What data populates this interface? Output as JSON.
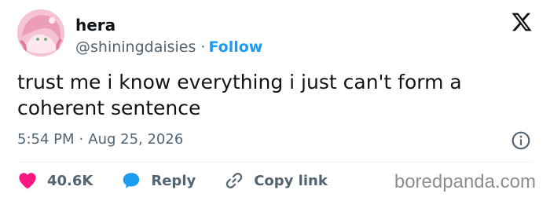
{
  "user": {
    "name": "hera",
    "handle": "@shiningdaisies",
    "separator": "·",
    "follow_label": "Follow"
  },
  "tweet": {
    "text": "trust me i know everything i just can't form a coherent sentence",
    "time": "5:54 PM",
    "meta_separator": "·",
    "date": "Aug 25, 2026"
  },
  "actions": {
    "likes": "40.6K",
    "reply_label": "Reply",
    "copy_link_label": "Copy link"
  },
  "icons": {
    "logo": "x-logo-icon",
    "info": "info-icon",
    "like": "heart-icon",
    "reply": "speech-bubble-icon",
    "copy_link": "link-icon"
  },
  "colors": {
    "link": "#1d9bf0",
    "muted": "#536471",
    "like": "#f91880",
    "text": "#0f1419"
  },
  "watermark": "boredpanda.com"
}
